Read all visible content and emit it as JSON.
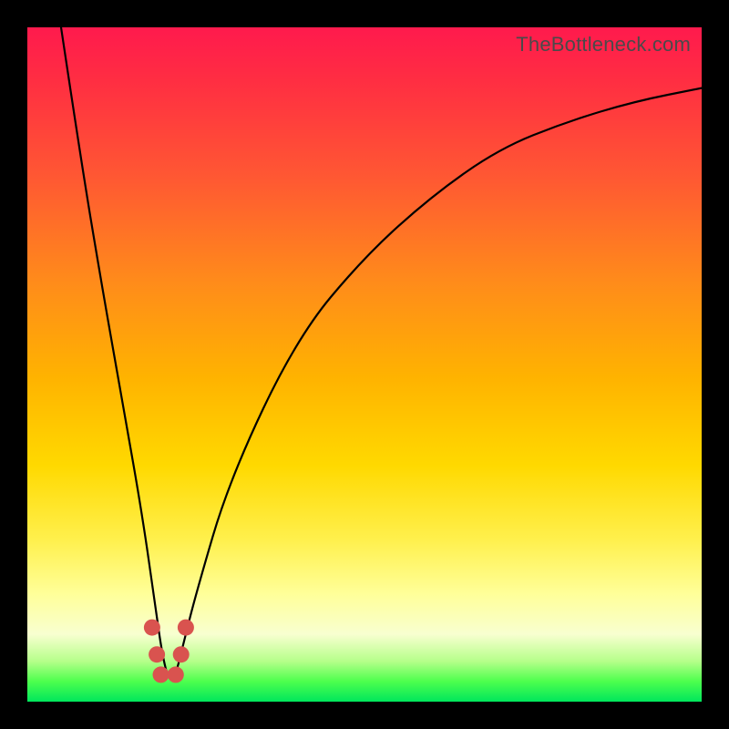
{
  "watermark": "TheBottleneck.com",
  "colors": {
    "page_bg": "#000000",
    "curve_stroke": "#000000",
    "marker_fill": "#d9534f",
    "gradient_stops": [
      "#ff1a4d",
      "#ff2e42",
      "#ff5733",
      "#ff8c1a",
      "#ffb300",
      "#ffd900",
      "#fff04d",
      "#ffff99",
      "#f8ffd0",
      "#b6ff8a",
      "#4dff4d",
      "#00e65c"
    ]
  },
  "chart_data": {
    "type": "line",
    "title": "",
    "xlabel": "",
    "ylabel": "",
    "xlim": [
      0,
      100
    ],
    "ylim": [
      0,
      100
    ],
    "grid": false,
    "legend": false,
    "note": "Bottleneck-style V curve. x is horizontal position (0-100), value is vertical height from bottom (0=green baseline, 100=top red). Minimum near x≈21.",
    "series": [
      {
        "name": "bottleneck_curve",
        "x": [
          5,
          8,
          11,
          14,
          17,
          19,
          20,
          21,
          22,
          23,
          25,
          30,
          40,
          50,
          60,
          70,
          80,
          90,
          100
        ],
        "values": [
          100,
          80,
          62,
          45,
          28,
          14,
          7,
          3,
          4,
          8,
          16,
          33,
          54,
          66,
          75,
          82,
          86,
          89,
          91
        ]
      }
    ],
    "markers": {
      "note": "red rounded markers clustered at the trough of the V",
      "x": [
        18.5,
        19.2,
        19.8,
        22.0,
        22.8,
        23.5
      ],
      "values": [
        11,
        7,
        4,
        4,
        7,
        11
      ],
      "radius": 9
    }
  }
}
